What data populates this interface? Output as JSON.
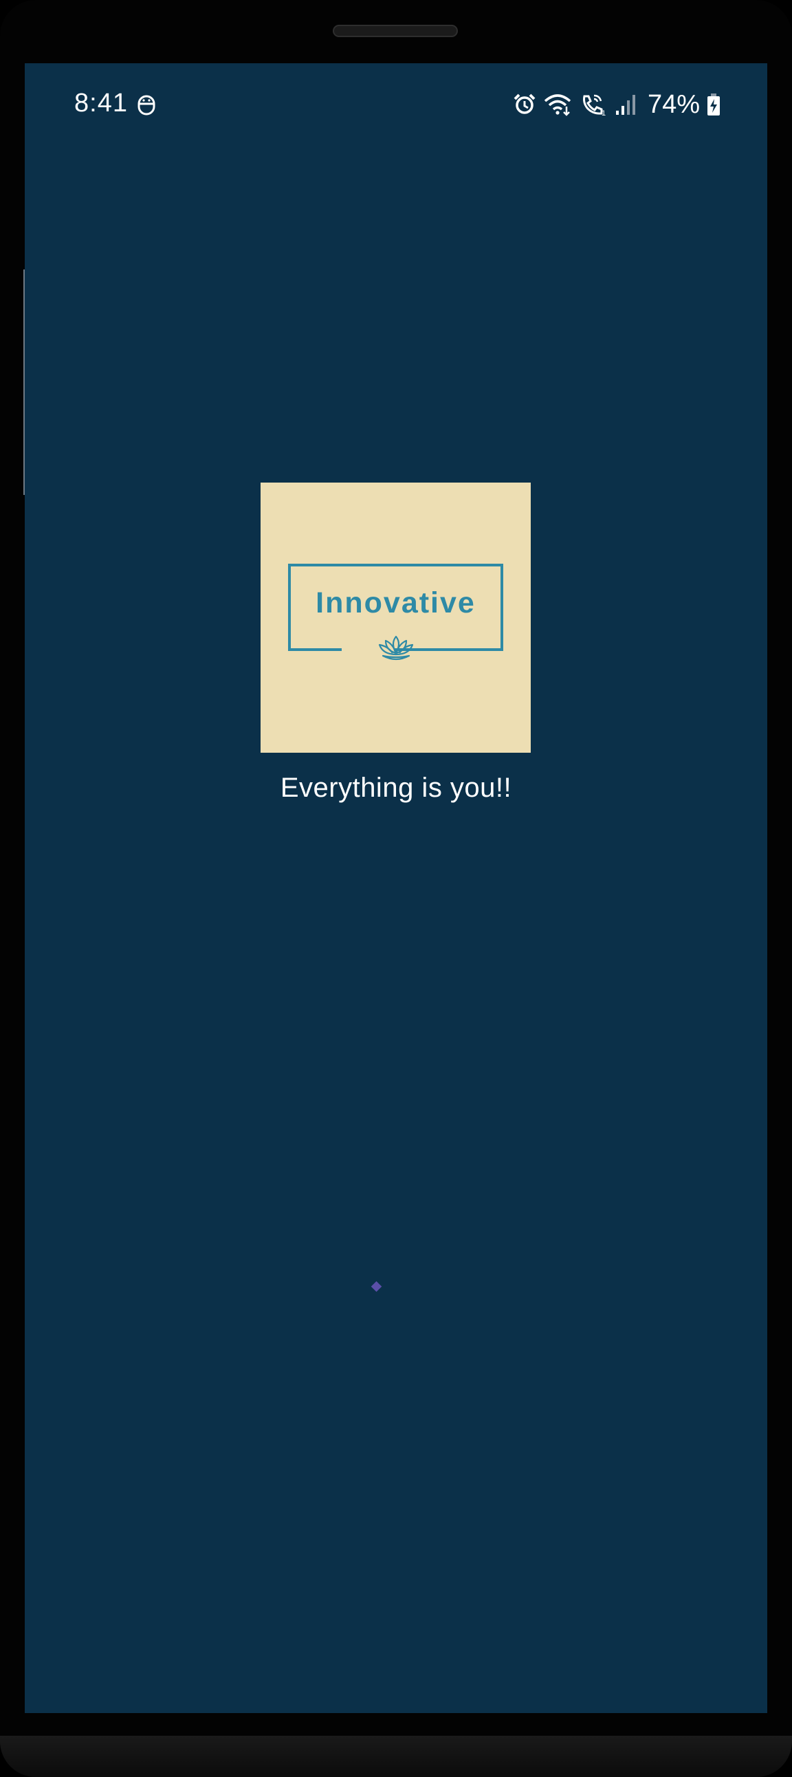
{
  "status_bar": {
    "time": "8:41",
    "left_icon": "assistant-face-icon",
    "icons": [
      "alarm-icon",
      "wifi-icon",
      "wifi-calling-icon",
      "signal-icon",
      "battery-charging-icon"
    ],
    "battery_percent": "74%"
  },
  "splash": {
    "logo_text": "Innovative",
    "logo_icon": "lotus-icon",
    "tagline": "Everything is you!!",
    "loading_icon": "loading-indicator-icon"
  },
  "colors": {
    "screen_background": "#0b3049",
    "logo_background": "#eddeb3",
    "logo_accent": "#2e8aa6",
    "text": "#ffffff",
    "loader": "#5b4fa8"
  }
}
